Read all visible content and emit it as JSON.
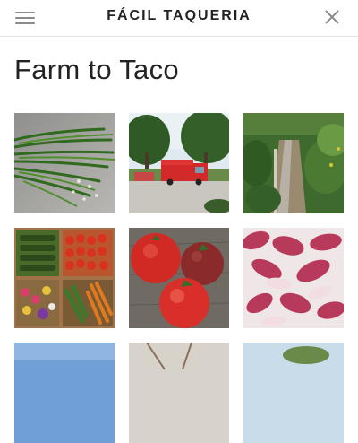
{
  "header": {
    "site_title": "FÁCIL TAQUERIA",
    "menu_icon": "hamburger-menu-icon",
    "close_icon": "close-icon"
  },
  "main": {
    "page_title": "Farm to Taco"
  },
  "gallery": {
    "columns": 3,
    "visible_rows": 3
  }
}
